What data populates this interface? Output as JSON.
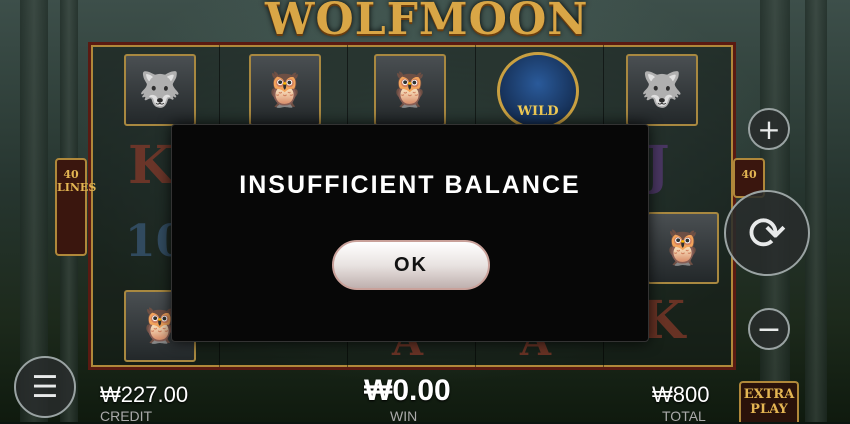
{
  "game": {
    "title": "WOLFMOON"
  },
  "paylines": {
    "left": "40 LINES",
    "right": "40"
  },
  "modal": {
    "message": "INSUFFICIENT BALANCE",
    "ok_label": "OK"
  },
  "reels": {
    "wild_label": "WILD",
    "row2_left": "K",
    "row2_right": "J",
    "row3_left": "10",
    "row4_a1": "A",
    "row4_a2": "A",
    "row4_right": "K"
  },
  "footer": {
    "credit_value": "₩227.00",
    "credit_label": "CREDIT",
    "win_value": "₩0.00",
    "win_label": "WIN",
    "total_value": "₩800",
    "total_label": "TOTAL",
    "extra_play_label": "EXTRA PLAY"
  },
  "icons": [
    "plus-icon",
    "spin-icon",
    "minus-icon",
    "menu-icon"
  ]
}
